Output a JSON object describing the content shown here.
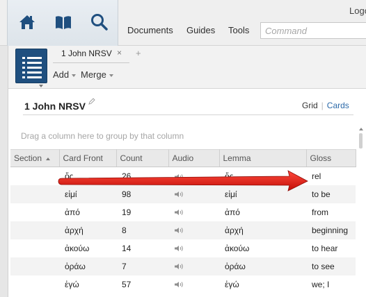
{
  "app": {
    "logo_text": "Logo",
    "menu": [
      "Documents",
      "Guides",
      "Tools"
    ],
    "command_placeholder": "Command",
    "icons": [
      "home-icon",
      "library-icon",
      "search-icon"
    ]
  },
  "tab": {
    "title": "1 John NRSV",
    "close_glyph": "×",
    "add_glyph": "+"
  },
  "toolbar": {
    "add_label": "Add",
    "merge_label": "Merge"
  },
  "document": {
    "title": "1 John NRSV",
    "view_grid": "Grid",
    "view_separator": "|",
    "view_cards": "Cards",
    "group_hint": "Drag a column here to group by that column"
  },
  "table": {
    "columns": [
      "Section",
      "Card Front",
      "Count",
      "Audio",
      "Lemma",
      "Gloss"
    ],
    "sorted_column": "Section",
    "rows": [
      {
        "section": "",
        "card_front": "ὅς",
        "count": "26",
        "audio": "speaker-icon",
        "lemma": "ὅς",
        "gloss": "rel"
      },
      {
        "section": "",
        "card_front": "εἰμί",
        "count": "98",
        "audio": "speaker-icon",
        "lemma": "εἰμί",
        "gloss": "to be"
      },
      {
        "section": "",
        "card_front": "ἀπό",
        "count": "19",
        "audio": "speaker-icon",
        "lemma": "ἀπό",
        "gloss": "from"
      },
      {
        "section": "",
        "card_front": "ἀρχή",
        "count": "8",
        "audio": "speaker-icon",
        "lemma": "ἀρχή",
        "gloss": "beginning"
      },
      {
        "section": "",
        "card_front": "ἀκούω",
        "count": "14",
        "audio": "speaker-icon",
        "lemma": "ἀκούω",
        "gloss": "to hear"
      },
      {
        "section": "",
        "card_front": "ὁράω",
        "count": "7",
        "audio": "speaker-icon",
        "lemma": "ὁράω",
        "gloss": "to see"
      },
      {
        "section": "",
        "card_front": "ἐγώ",
        "count": "57",
        "audio": "speaker-icon",
        "lemma": "ἐγώ",
        "gloss": "we; I"
      }
    ]
  },
  "colors": {
    "accent_link": "#2c6aa9",
    "panel_icon_bg": "#1f4f7f",
    "annotation_arrow": "#e3120b"
  }
}
